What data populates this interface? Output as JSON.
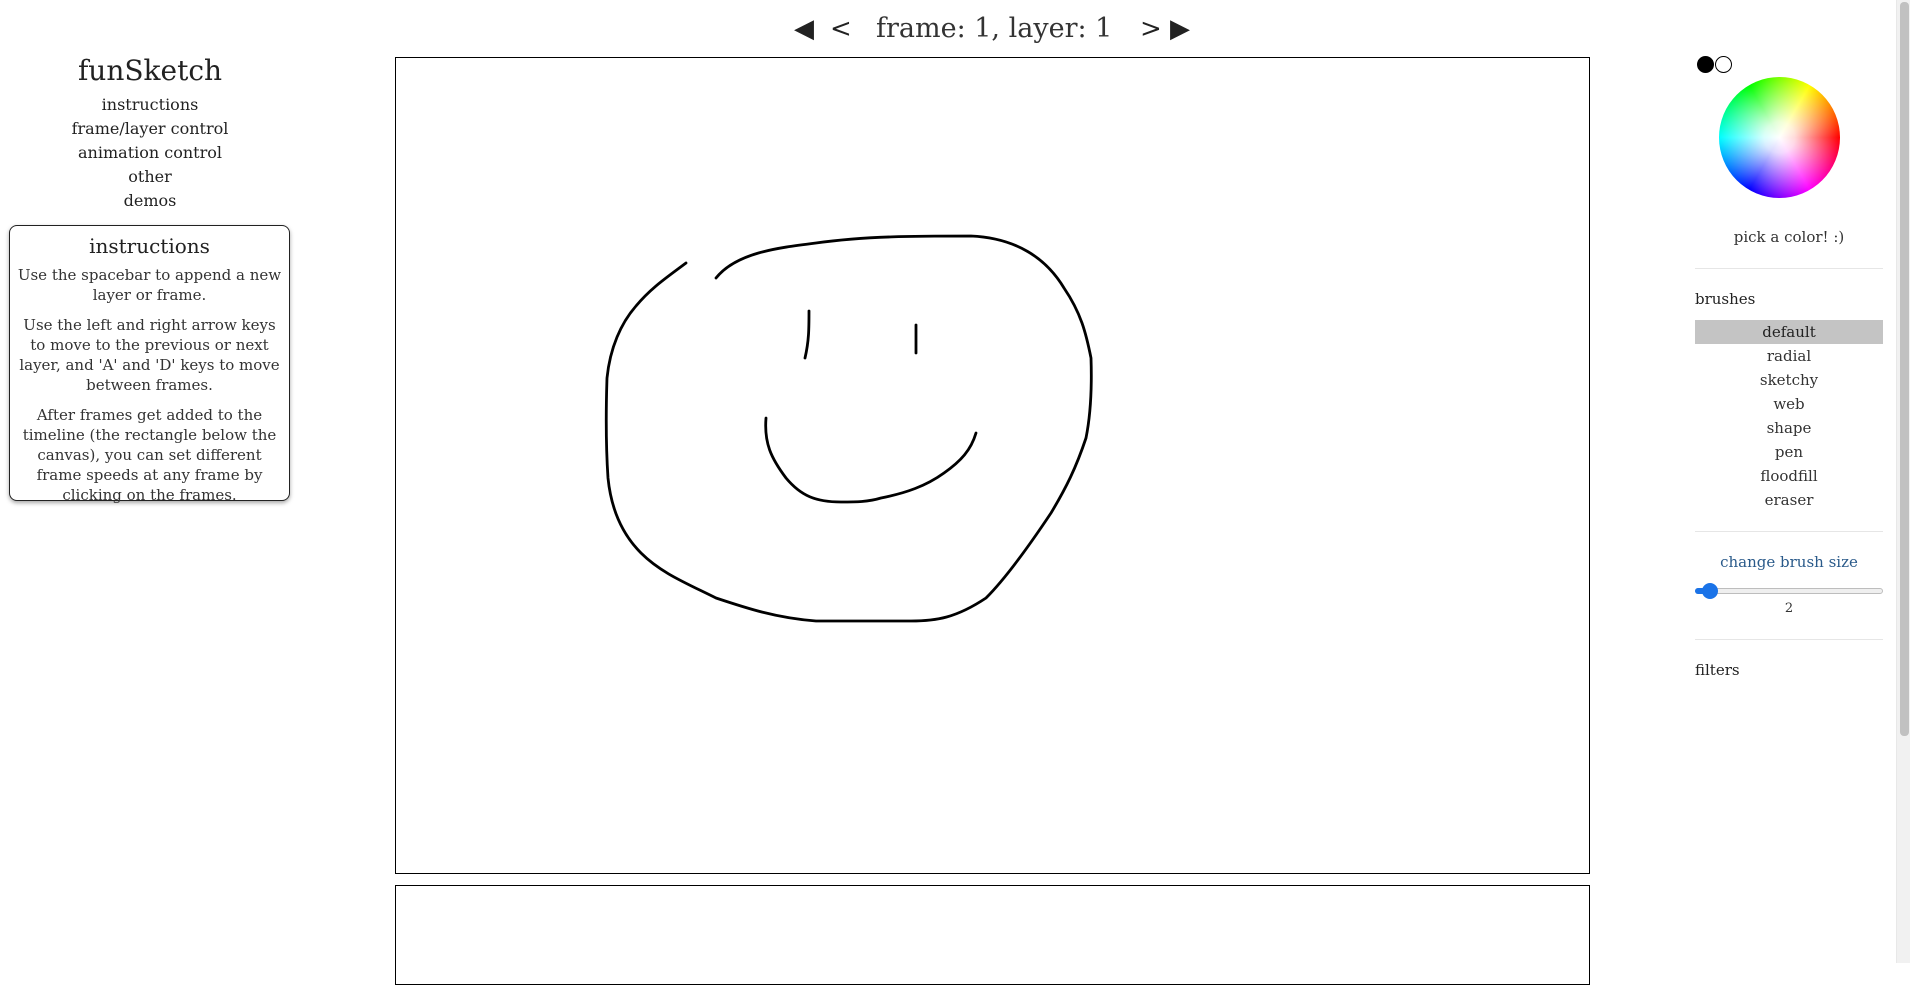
{
  "frame_nav": {
    "first_icon": "triangle-left-icon",
    "first_glyph": "◀",
    "prev_glyph": "<",
    "label": "frame: 1, layer: 1",
    "next_glyph": ">",
    "last_icon": "triangle-right-icon",
    "last_glyph": "▶"
  },
  "sidebar": {
    "title": "funSketch",
    "menu": [
      {
        "label": "instructions"
      },
      {
        "label": "frame/layer control"
      },
      {
        "label": "animation control"
      },
      {
        "label": "other"
      },
      {
        "label": "demos"
      }
    ]
  },
  "instructions": {
    "heading": "instructions",
    "paragraphs": [
      "Use the spacebar to append a new layer or frame.",
      "Use the left and right arrow keys to move to the previous or next layer, and 'A' and 'D' keys to move between frames.",
      "After frames get added to the timeline (the rectangle below the canvas), you can set different frame speeds at any frame by clicking on the frames."
    ]
  },
  "color_panel": {
    "primary_color": "#000000",
    "secondary_color": "#ffffff",
    "pick_text": "pick a color! :)"
  },
  "brushes": {
    "label": "brushes",
    "selected": "default",
    "items": [
      {
        "label": "default"
      },
      {
        "label": "radial"
      },
      {
        "label": "sketchy"
      },
      {
        "label": "web"
      },
      {
        "label": "shape"
      },
      {
        "label": "pen"
      },
      {
        "label": "floodfill"
      },
      {
        "label": "eraser"
      }
    ]
  },
  "brush_size": {
    "label": "change brush size",
    "value": "2",
    "fraction": 0.04,
    "accent": "#1a73e8"
  },
  "filters": {
    "label": "filters"
  }
}
